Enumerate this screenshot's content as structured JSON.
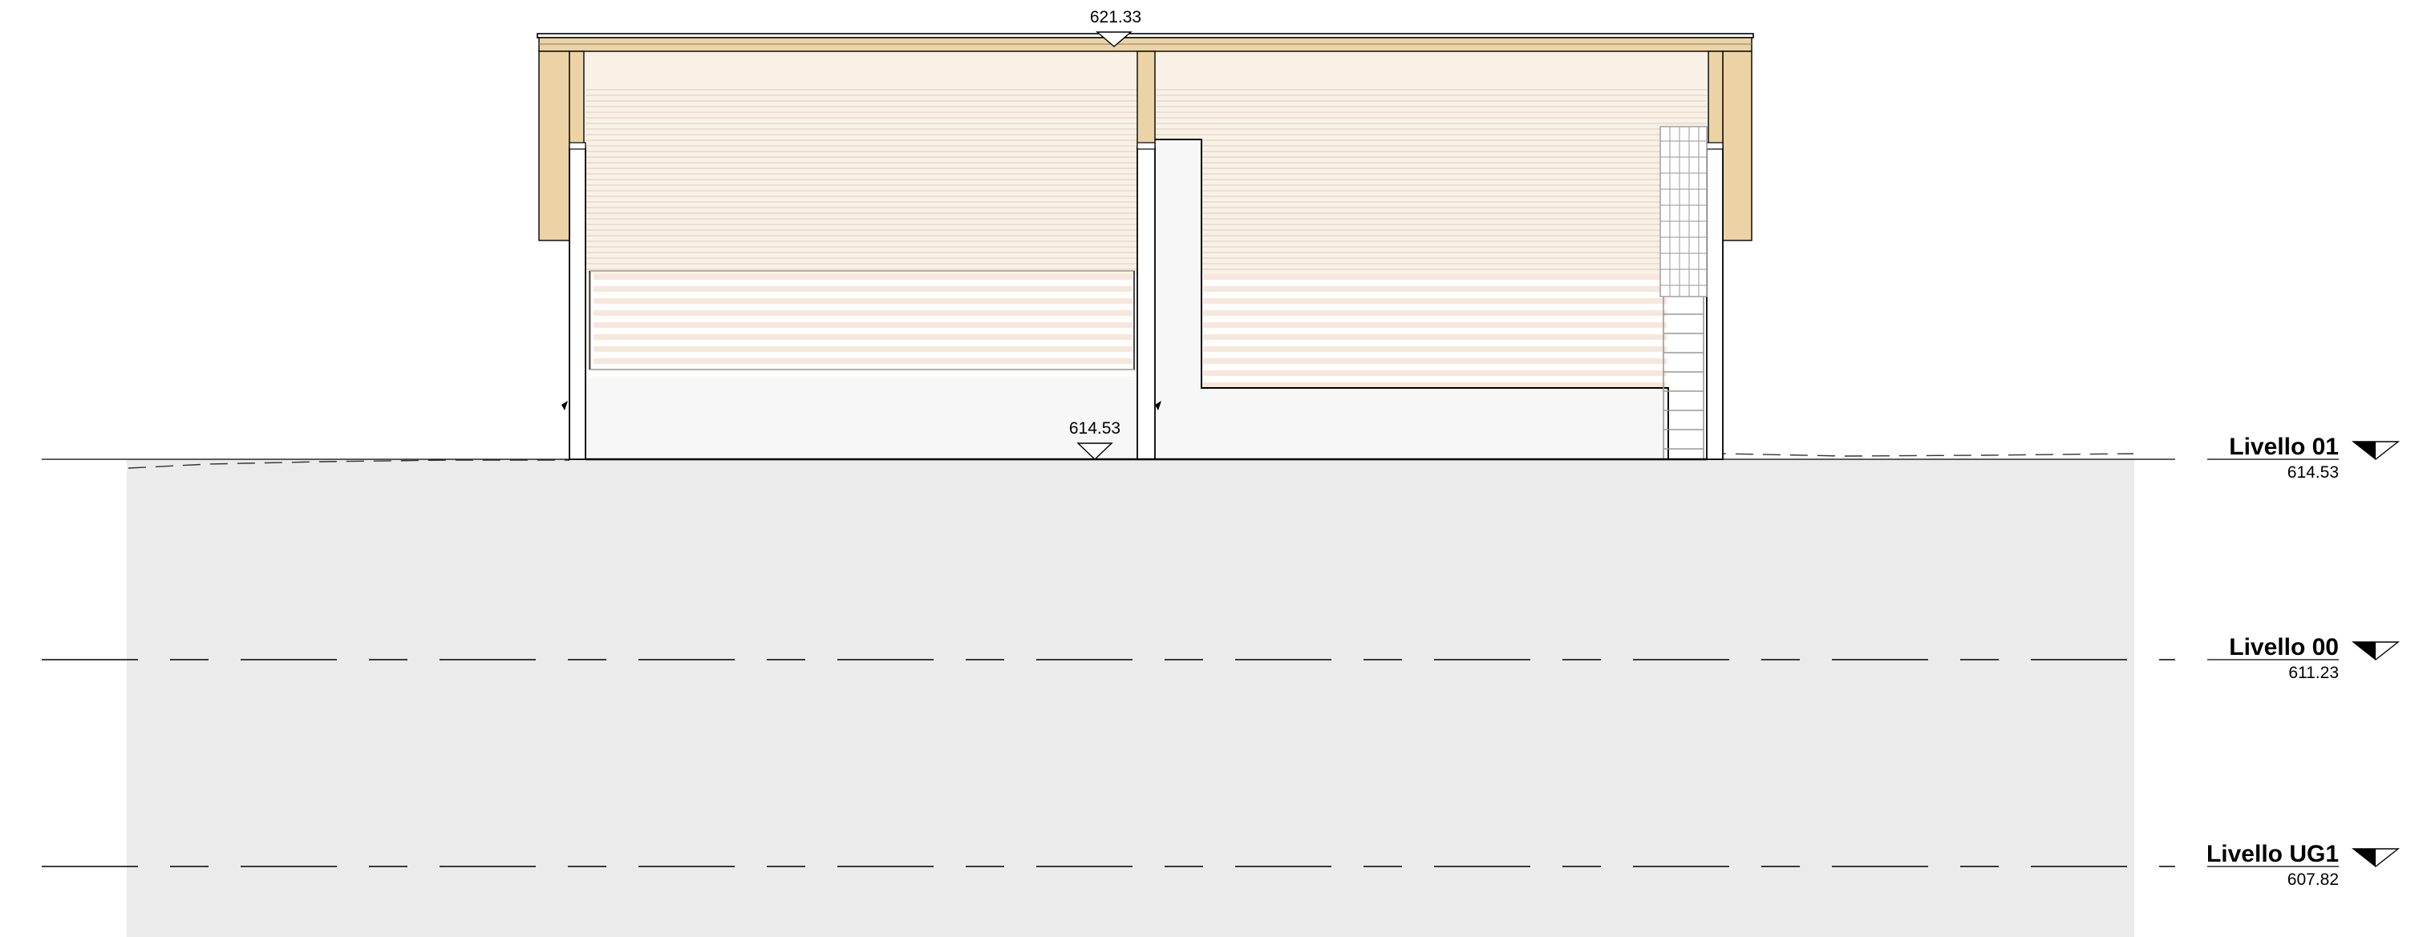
{
  "spot_elevations": {
    "ridge": "621.33",
    "floor": "614.53"
  },
  "levels": [
    {
      "name": "Livello 01",
      "elevation": "614.53"
    },
    {
      "name": "Livello 00",
      "elevation": "611.23"
    },
    {
      "name": "Livello UG1",
      "elevation": "607.82"
    }
  ],
  "colors": {
    "ground_fill": "#ebebeb",
    "timber": "#ecd3a6",
    "timber_light": "#f6ecdd",
    "cladding_line": "#d9cdbd",
    "line": "#000000"
  }
}
